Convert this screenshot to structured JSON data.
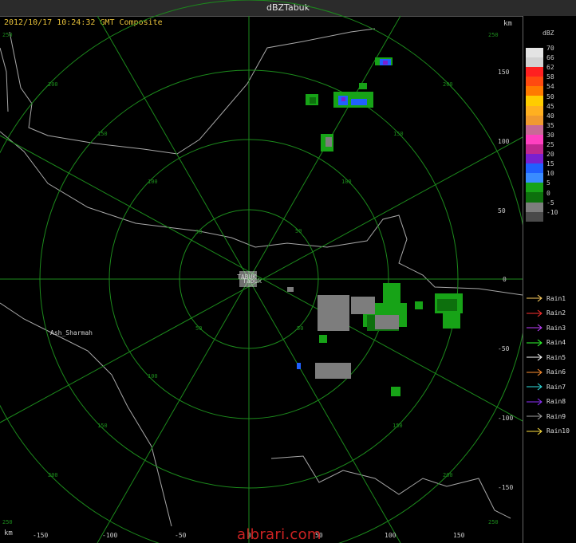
{
  "window": {
    "title": "dBZTabuk"
  },
  "header": {
    "caption": "2012/10/17 10:24:32 GMT Composite",
    "km_top": "km",
    "km_bottom": "km"
  },
  "colors": {
    "grid": "#1c8a1c",
    "border": "#a7a7a7",
    "caption": "#e8c23a"
  },
  "axis": {
    "x_ticks": [
      "-150",
      "-100",
      "-50",
      "0",
      "50",
      "100",
      "150"
    ],
    "y_ticks": [
      "150",
      "100",
      "50",
      "0",
      "-50",
      "-100",
      "-150"
    ]
  },
  "ring_labels": [
    "50",
    "100",
    "150",
    "200",
    "250"
  ],
  "places": {
    "station": "Tabuk",
    "station_alt": "TABUK",
    "city": "Ash_Sharmah"
  },
  "legend": {
    "title": "dBZ",
    "levels": [
      "70",
      "66",
      "62",
      "58",
      "54",
      "50",
      "45",
      "40",
      "35",
      "30",
      "25",
      "20",
      "15",
      "10",
      "5",
      "0",
      "-5",
      "-10"
    ],
    "colors": [
      "#e4e4e4",
      "#d2d2d2",
      "#ff2020",
      "#ff4a10",
      "#ff7a00",
      "#ffcc00",
      "#ffb020",
      "#f09a30",
      "#c86a96",
      "#ff40c0",
      "#c02890",
      "#7a20d0",
      "#2060ff",
      "#3a8cff",
      "#17a317",
      "#0d700d",
      "#7d7d7d",
      "#4a4a4a"
    ],
    "rains": [
      {
        "label": "Rain1",
        "color": "#ffd060"
      },
      {
        "label": "Rain2",
        "color": "#ff3030"
      },
      {
        "label": "Rain3",
        "color": "#c040ff"
      },
      {
        "label": "Rain4",
        "color": "#30ff30"
      },
      {
        "label": "Rain5",
        "color": "#ffffff"
      },
      {
        "label": "Rain6",
        "color": "#ff9030"
      },
      {
        "label": "Rain7",
        "color": "#30e0e0"
      },
      {
        "label": "Rain8",
        "color": "#9030ff"
      },
      {
        "label": "Rain9",
        "color": "#a0a0a0"
      },
      {
        "label": "Rain10",
        "color": "#ffe040"
      }
    ]
  },
  "watermark": "albrari.com"
}
